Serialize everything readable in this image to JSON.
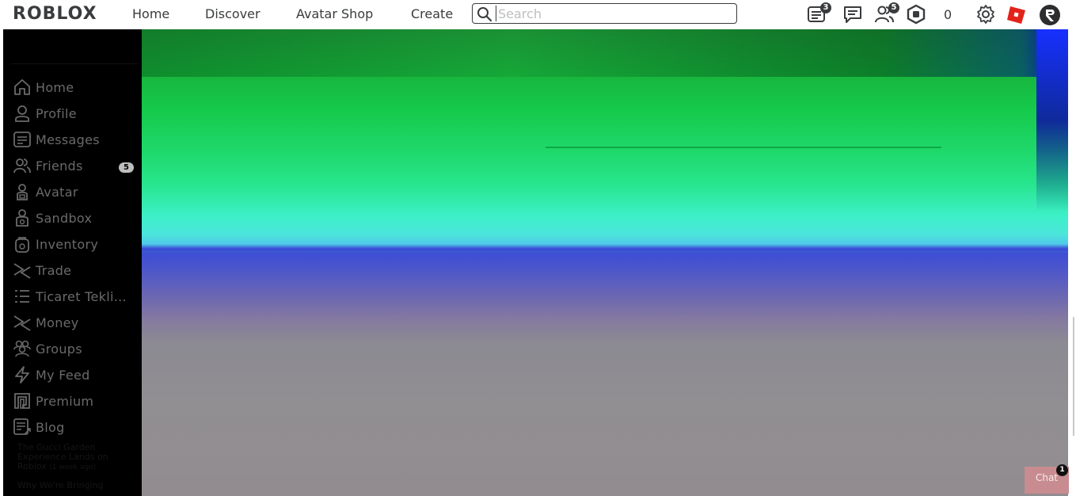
{
  "header": {
    "logo": "ROBLOX",
    "nav": [
      "Home",
      "Discover",
      "Avatar Shop",
      "Create"
    ],
    "search_placeholder": "Search",
    "notifications_badge": "3",
    "friends_badge": "5",
    "robux_count": "0"
  },
  "sidebar": {
    "items": [
      {
        "label": "Home",
        "icon": "home-icon"
      },
      {
        "label": "Profile",
        "icon": "profile-icon"
      },
      {
        "label": "Messages",
        "icon": "messages-icon"
      },
      {
        "label": "Friends",
        "icon": "friends-icon",
        "badge": "5"
      },
      {
        "label": "Avatar",
        "icon": "avatar-icon"
      },
      {
        "label": "Sandbox",
        "icon": "sandbox-icon"
      },
      {
        "label": "Inventory",
        "icon": "inventory-icon"
      },
      {
        "label": "Trade",
        "icon": "trade-icon"
      },
      {
        "label": "Ticaret Tekli...",
        "icon": "list-icon"
      },
      {
        "label": "Money",
        "icon": "money-icon"
      },
      {
        "label": "Groups",
        "icon": "groups-icon"
      },
      {
        "label": "My Feed",
        "icon": "feed-icon"
      },
      {
        "label": "Premium",
        "icon": "premium-icon"
      },
      {
        "label": "Blog",
        "icon": "blog-icon"
      }
    ],
    "blog_posts": [
      {
        "title": "The Gucci Garden Experience Lands on Roblox",
        "age": "(1 week ago)"
      },
      {
        "title": "Why We're Bringing",
        "age": ""
      }
    ]
  },
  "chat": {
    "label": "Chat",
    "badge": "1"
  },
  "colors": {
    "sidebar_bg": "#000000",
    "sidebar_text": "#6a6a6a",
    "header_text": "#393b3d"
  }
}
